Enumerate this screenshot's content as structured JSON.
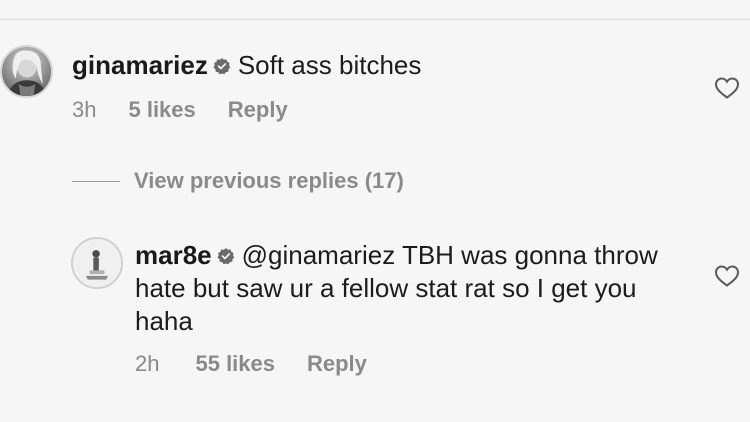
{
  "comments": [
    {
      "username": "ginamariez",
      "verified": true,
      "text": "Soft ass bitches",
      "time": "3h",
      "likes": "5 likes",
      "reply_label": "Reply"
    },
    {
      "username": "mar8e",
      "verified": true,
      "text": "@ginamariez TBH was gonna throw hate but saw ur a fellow stat rat so I get you haha",
      "time": "2h",
      "likes": "55 likes",
      "reply_label": "Reply"
    }
  ],
  "view_replies": {
    "label": "View previous replies (17)"
  },
  "icons": {
    "verified": "verified-badge-icon",
    "like": "heart-outline-icon"
  },
  "colors": {
    "background": "#f6f6f6",
    "text": "#1c1c1c",
    "muted": "#8a8a8a"
  }
}
